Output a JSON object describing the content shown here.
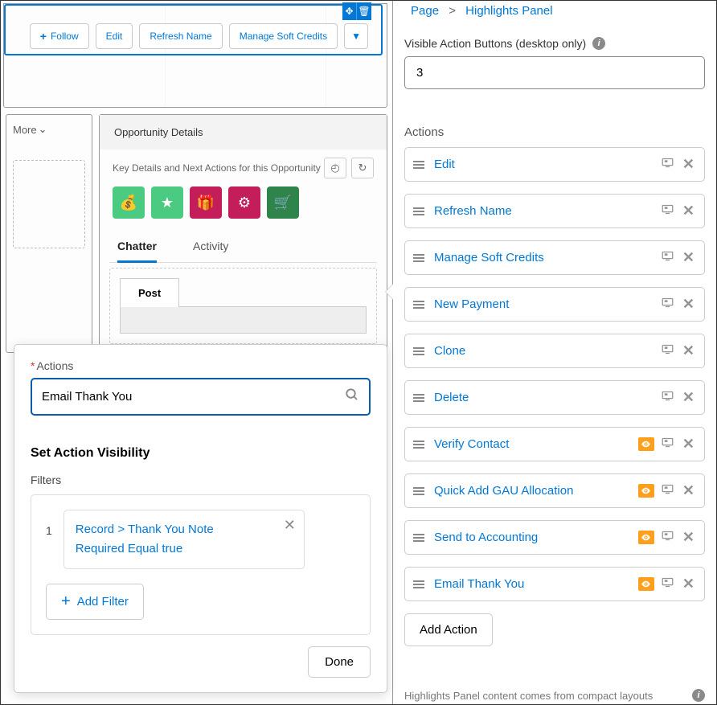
{
  "breadcrumb": {
    "parent": "Page",
    "current": "Highlights Panel"
  },
  "visible_action_buttons": {
    "label": "Visible Action Buttons (desktop only)",
    "value": "3"
  },
  "actions_header": "Actions",
  "action_items": [
    {
      "name": "Edit",
      "has_eye": false
    },
    {
      "name": "Refresh Name",
      "has_eye": false
    },
    {
      "name": "Manage Soft Credits",
      "has_eye": false
    },
    {
      "name": "New Payment",
      "has_eye": false
    },
    {
      "name": "Clone",
      "has_eye": false
    },
    {
      "name": "Delete",
      "has_eye": false
    },
    {
      "name": "Verify Contact",
      "has_eye": true
    },
    {
      "name": "Quick Add GAU Allocation",
      "has_eye": true
    },
    {
      "name": "Send to Accounting",
      "has_eye": true
    },
    {
      "name": "Email Thank You",
      "has_eye": true
    }
  ],
  "add_action_label": "Add Action",
  "preview": {
    "action_bar": {
      "follow": "Follow",
      "edit": "Edit",
      "refresh_name": "Refresh Name",
      "manage_soft": "Manage Soft Credits"
    },
    "more_label": "More",
    "opp_details": "Opportunity Details",
    "key_details": "Key Details and Next Actions for this Opportunity",
    "tab_chatter": "Chatter",
    "tab_activity": "Activity",
    "post_tab": "Post"
  },
  "popover": {
    "actions_label": "Actions",
    "search_value": "Email Thank You",
    "set_visibility": "Set Action Visibility",
    "filters_label": "Filters",
    "filter_index": "1",
    "filter_line1": "Record > Thank You Note",
    "filter_line2": "Required Equal true",
    "add_filter": "Add Filter",
    "done": "Done"
  },
  "footer_note": "Highlights Panel content comes from compact layouts"
}
